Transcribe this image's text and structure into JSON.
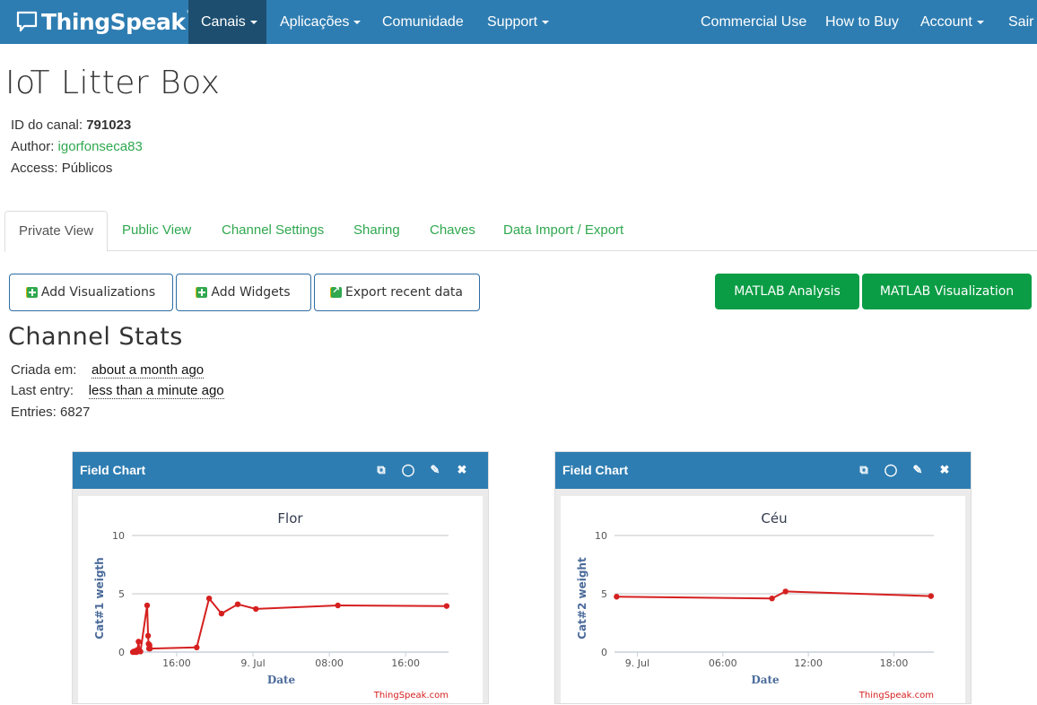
{
  "navbar": {
    "brand": "ThingSpeak",
    "brand_tm": "™",
    "items_left": [
      {
        "label": "Canais",
        "dropdown": true,
        "active": true
      },
      {
        "label": "Aplicações",
        "dropdown": true,
        "active": false
      },
      {
        "label": "Comunidade",
        "dropdown": false,
        "active": false
      },
      {
        "label": "Support",
        "dropdown": true,
        "active": false
      }
    ],
    "items_right": [
      {
        "label": "Commercial Use",
        "dropdown": false
      },
      {
        "label": "How to Buy",
        "dropdown": false
      },
      {
        "label": "Account",
        "dropdown": true
      },
      {
        "label": "Sair",
        "dropdown": false
      }
    ]
  },
  "channel": {
    "title": "IoT Litter Box",
    "id_label": "ID do canal:",
    "id_value": "791023",
    "author_label": "Author:",
    "author_value": "igorfonseca83",
    "access_label": "Access:",
    "access_value": "Públicos"
  },
  "tabs": [
    {
      "label": "Private View",
      "active": true
    },
    {
      "label": "Public View",
      "active": false
    },
    {
      "label": "Channel Settings",
      "active": false
    },
    {
      "label": "Sharing",
      "active": false
    },
    {
      "label": "Chaves",
      "active": false
    },
    {
      "label": "Data Import / Export",
      "active": false
    }
  ],
  "actions": {
    "add_visualizations": "Add Visualizations",
    "add_widgets": "Add Widgets",
    "export_recent": "Export recent data",
    "matlab_analysis": "MATLAB Analysis",
    "matlab_visualization": "MATLAB Visualization"
  },
  "stats": {
    "title": "Channel Stats",
    "created_label": "Criada em:",
    "created_value": "about a month ago",
    "last_entry_label": "Last entry:",
    "last_entry_value": "less than a minute ago",
    "entries_label": "Entries:",
    "entries_value": "6827"
  },
  "panels": [
    {
      "header": "Field Chart",
      "icons": [
        "external-link-icon",
        "comment-icon",
        "pencil-icon",
        "close-icon"
      ]
    },
    {
      "header": "Field Chart",
      "icons": [
        "external-link-icon",
        "comment-icon",
        "pencil-icon",
        "close-icon"
      ]
    }
  ],
  "colors": {
    "navbar": "#2e7db2",
    "navbar_active": "#1d4e6f",
    "link_green": "#2fa84f",
    "button_green": "#0b9d45",
    "series_red": "#d62020",
    "axis_title_blue": "#4a6a9a"
  },
  "chart_data": [
    {
      "type": "line",
      "title": "Flor",
      "xlabel": "Date",
      "ylabel": "Cat#1 weigth",
      "ylim": [
        0,
        10
      ],
      "yticks": [
        0,
        5,
        10
      ],
      "x_unit": "hours relative to 9 Jul 00:00",
      "xlim": [
        -12.7,
        20.5
      ],
      "xticks": [
        {
          "x": -8,
          "label": "16:00"
        },
        {
          "x": 0,
          "label": "9. Jul"
        },
        {
          "x": 8,
          "label": "08:00"
        },
        {
          "x": 16,
          "label": "16:00"
        }
      ],
      "grid": true,
      "credit": "ThingSpeak.com",
      "series": [
        {
          "name": "Cat#1 weigth",
          "points": [
            [
              -12.6,
              0.0
            ],
            [
              -12.5,
              0.05
            ],
            [
              -12.4,
              0.0
            ],
            [
              -12.3,
              0.1
            ],
            [
              -12.2,
              0.0
            ],
            [
              -12.1,
              0.2
            ],
            [
              -12.0,
              0.9
            ],
            [
              -11.9,
              0.1
            ],
            [
              -11.8,
              0.05
            ],
            [
              -11.1,
              4.0
            ],
            [
              -11.0,
              1.4
            ],
            [
              -10.95,
              0.7
            ],
            [
              -10.9,
              0.3
            ],
            [
              -10.85,
              0.6
            ],
            [
              -10.8,
              0.3
            ],
            [
              -5.9,
              0.4
            ],
            [
              -4.6,
              4.6
            ],
            [
              -3.3,
              3.3
            ],
            [
              -1.6,
              4.1
            ],
            [
              0.3,
              3.7
            ],
            [
              8.9,
              4.0
            ],
            [
              20.3,
              3.95
            ]
          ]
        }
      ]
    },
    {
      "type": "line",
      "title": "Céu",
      "xlabel": "Date",
      "ylabel": "Cat#2 weight",
      "ylim": [
        0,
        10
      ],
      "yticks": [
        0,
        5,
        10
      ],
      "x_unit": "hours relative to 9 Jul 00:00",
      "xlim": [
        -1.6,
        20.8
      ],
      "xticks": [
        {
          "x": 0,
          "label": "9. Jul"
        },
        {
          "x": 6,
          "label": "06:00"
        },
        {
          "x": 12,
          "label": "12:00"
        },
        {
          "x": 18,
          "label": "18:00"
        }
      ],
      "grid": true,
      "credit": "ThingSpeak.com",
      "series": [
        {
          "name": "Cat#2 weight",
          "points": [
            [
              -1.45,
              4.75
            ],
            [
              9.45,
              4.6
            ],
            [
              10.4,
              5.2
            ],
            [
              20.6,
              4.8
            ]
          ]
        }
      ]
    }
  ]
}
